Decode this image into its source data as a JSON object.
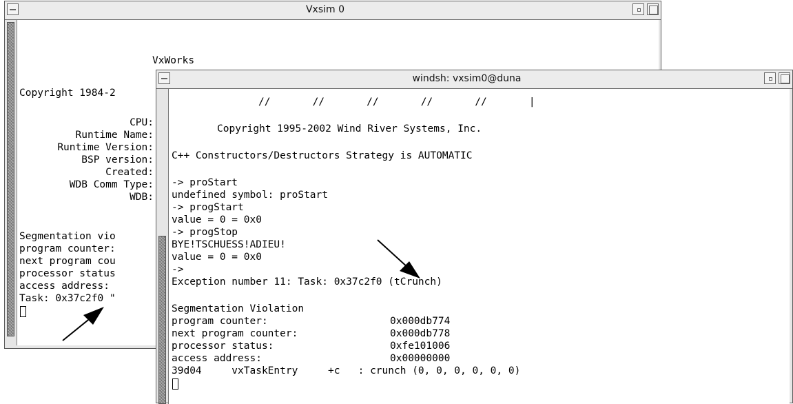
{
  "back_window": {
    "title": "Vxsim 0",
    "lines": [
      "VxWorks",
      "Copyright 1984-2",
      "CPU:",
      "Runtime Name:",
      "Runtime Version:",
      "BSP version:",
      "Created:",
      "WDB Comm Type:",
      "WDB:",
      "Segmentation vio",
      "program counter:",
      "next program cou",
      "processor status",
      "access address:",
      "Task: 0x37c2f0 \""
    ]
  },
  "front_window": {
    "title": "windsh: vxsim0@duna",
    "slashes": "//       //       //       //       //       |",
    "lines": [
      "Copyright 1995-2002 Wind River Systems, Inc.",
      "C++ Constructors/Destructors Strategy is AUTOMATIC",
      "-> proStart",
      "undefined symbol: proStart",
      "-> progStart",
      "value = 0 = 0x0",
      "-> progStop",
      "BYE!TSCHUESS!ADIEU!",
      "value = 0 = 0x0",
      "->",
      "Exception number 11: Task: 0x37c2f0 (tCrunch)",
      "Segmentation Violation",
      "program counter:",
      "next program counter:",
      "processor status:",
      "access address:",
      "39d04     vxTaskEntry     +c   : crunch (0, 0, 0, 0, 0, 0)"
    ],
    "values": [
      "0x000db774",
      "0x000db778",
      "0xfe101006",
      "0x00000000"
    ]
  },
  "icons": {
    "menu": "window-menu-icon",
    "minimize": "minimize-icon",
    "maximize": "maximize-icon",
    "arrow": "arrow-annotation-icon"
  }
}
